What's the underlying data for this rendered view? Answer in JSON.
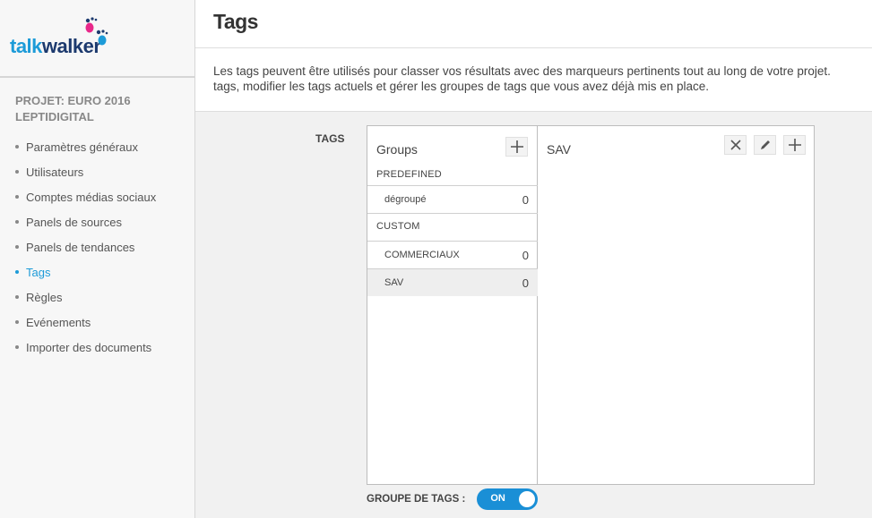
{
  "brand": {
    "part1": "talk",
    "part2": "walker"
  },
  "sidebar": {
    "project": "PROJET: EURO 2016 LEPTIDIGITAL",
    "items": [
      {
        "label": "Paramètres généraux"
      },
      {
        "label": "Utilisateurs"
      },
      {
        "label": "Comptes médias sociaux"
      },
      {
        "label": "Panels de sources"
      },
      {
        "label": "Panels de tendances"
      },
      {
        "label": "Tags",
        "active": true
      },
      {
        "label": "Règles"
      },
      {
        "label": "Evénements"
      },
      {
        "label": "Importer des documents"
      }
    ]
  },
  "header": {
    "title": "Tags"
  },
  "description": {
    "line1": "Les tags peuvent être utilisés pour classer vos résultats avec des marqueurs pertinents tout au long de votre projet.",
    "line2": "tags, modifier les tags actuels et gérer les groupes de tags que vous avez déjà mis en place."
  },
  "tags_section": {
    "label": "TAGS",
    "groups_title": "Groups",
    "predefined_label": "PREDEFINED",
    "custom_label": "CUSTOM",
    "predefined": [
      {
        "name": "dégroupé",
        "count": "0"
      }
    ],
    "custom": [
      {
        "name": "COMMERCIAUX",
        "count": "0"
      },
      {
        "name": "SAV",
        "count": "0",
        "selected": true
      }
    ],
    "detail_title": "SAV"
  },
  "toggle": {
    "label": "GROUPE DE TAGS :",
    "state": "ON",
    "color": "#1a8fd6"
  },
  "icons": {
    "add": "plus-icon",
    "close": "close-icon",
    "edit": "pencil-icon"
  },
  "colors": {
    "accent": "#1d9bd8",
    "brand_dark": "#1d3a6e"
  }
}
